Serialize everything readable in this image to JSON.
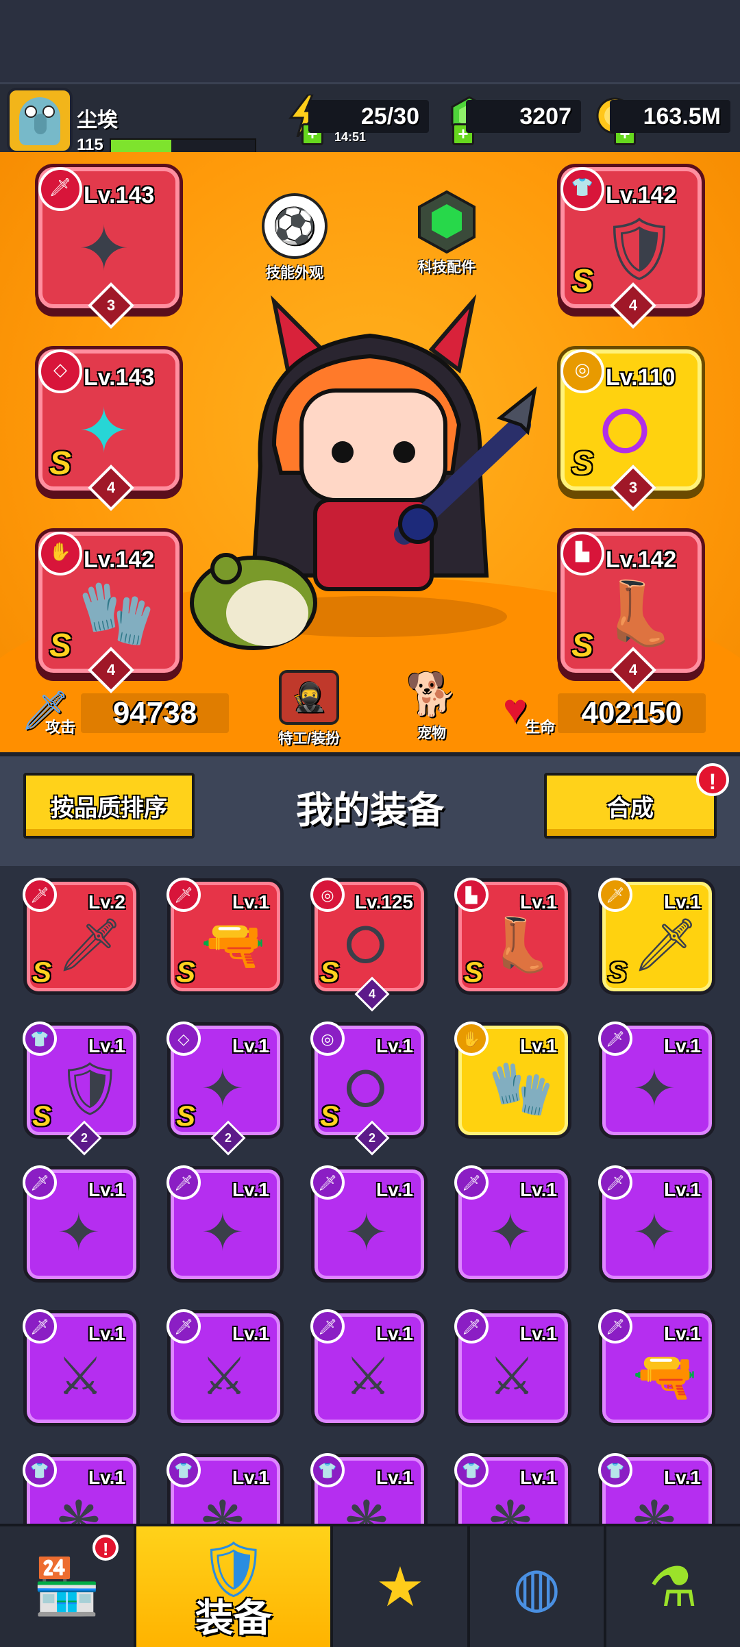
{
  "player": {
    "name": "尘埃",
    "level": "115",
    "xp_progress": 0.42
  },
  "resources": {
    "energy": "25/30",
    "energy_timer": "14:51",
    "gems": "3207",
    "gold": "163.5M"
  },
  "hero": {
    "buttons": {
      "skin": "技能外观",
      "tech": "科技配件",
      "agent": "特工/装扮",
      "pet": "宠物"
    },
    "stats": {
      "attack_label": "攻击",
      "attack": "94738",
      "hp_label": "生命",
      "hp": "402150"
    },
    "equipped": [
      {
        "slot": "weapon",
        "level": "Lv.143",
        "count": "3",
        "rarity": "red",
        "grade": "",
        "art": "kunai"
      },
      {
        "slot": "armor",
        "level": "Lv.142",
        "count": "4",
        "rarity": "red",
        "grade": "S",
        "art": "armor"
      },
      {
        "slot": "necklace",
        "level": "Lv.143",
        "count": "4",
        "rarity": "red",
        "grade": "S",
        "art": "necklace"
      },
      {
        "slot": "belt",
        "level": "Lv.110",
        "count": "3",
        "rarity": "gold",
        "grade": "S",
        "art": "belt"
      },
      {
        "slot": "gloves",
        "level": "Lv.142",
        "count": "4",
        "rarity": "red",
        "grade": "S",
        "art": "gloves"
      },
      {
        "slot": "boots",
        "level": "Lv.142",
        "count": "4",
        "rarity": "red",
        "grade": "S",
        "art": "boots"
      }
    ]
  },
  "section": {
    "sort_button": "按品质排序",
    "title": "我的装备",
    "merge_button": "合成",
    "alert": "!"
  },
  "inventory": [
    [
      {
        "level": "Lv.2",
        "rarity": "red",
        "grade": "S",
        "slot_icon": "🗡",
        "art": "🗡",
        "count": ""
      },
      {
        "level": "Lv.1",
        "rarity": "red",
        "grade": "S",
        "slot_icon": "🗡",
        "art": "🔫",
        "count": ""
      },
      {
        "level": "Lv.125",
        "rarity": "red",
        "grade": "S",
        "slot_icon": "◎",
        "art": "⭘",
        "count": "4"
      },
      {
        "level": "Lv.1",
        "rarity": "red",
        "grade": "S",
        "slot_icon": "▙",
        "art": "👢",
        "count": ""
      },
      {
        "level": "Lv.1",
        "rarity": "gold",
        "grade": "S",
        "slot_icon": "🗡",
        "art": "🗡",
        "count": ""
      }
    ],
    [
      {
        "level": "Lv.1",
        "rarity": "purple",
        "grade": "S",
        "slot_icon": "👕",
        "art": "🛡",
        "count": "2"
      },
      {
        "level": "Lv.1",
        "rarity": "purple",
        "grade": "S",
        "slot_icon": "◇",
        "art": "✦",
        "count": "2"
      },
      {
        "level": "Lv.1",
        "rarity": "purple",
        "grade": "S",
        "slot_icon": "◎",
        "art": "⭘",
        "count": "2"
      },
      {
        "level": "Lv.1",
        "rarity": "gold",
        "grade": "",
        "slot_icon": "✋",
        "art": "🧤",
        "count": ""
      },
      {
        "level": "Lv.1",
        "rarity": "purple",
        "grade": "",
        "slot_icon": "🗡",
        "art": "✦",
        "count": ""
      }
    ],
    [
      {
        "level": "Lv.1",
        "rarity": "purple",
        "grade": "",
        "slot_icon": "🗡",
        "art": "✦",
        "count": ""
      },
      {
        "level": "Lv.1",
        "rarity": "purple",
        "grade": "",
        "slot_icon": "🗡",
        "art": "✦",
        "count": ""
      },
      {
        "level": "Lv.1",
        "rarity": "purple",
        "grade": "",
        "slot_icon": "🗡",
        "art": "✦",
        "count": ""
      },
      {
        "level": "Lv.1",
        "rarity": "purple",
        "grade": "",
        "slot_icon": "🗡",
        "art": "✦",
        "count": ""
      },
      {
        "level": "Lv.1",
        "rarity": "purple",
        "grade": "",
        "slot_icon": "🗡",
        "art": "✦",
        "count": ""
      }
    ],
    [
      {
        "level": "Lv.1",
        "rarity": "purple",
        "grade": "",
        "slot_icon": "🗡",
        "art": "⚔",
        "count": ""
      },
      {
        "level": "Lv.1",
        "rarity": "purple",
        "grade": "",
        "slot_icon": "🗡",
        "art": "⚔",
        "count": ""
      },
      {
        "level": "Lv.1",
        "rarity": "purple",
        "grade": "",
        "slot_icon": "🗡",
        "art": "⚔",
        "count": ""
      },
      {
        "level": "Lv.1",
        "rarity": "purple",
        "grade": "",
        "slot_icon": "🗡",
        "art": "⚔",
        "count": ""
      },
      {
        "level": "Lv.1",
        "rarity": "purple",
        "grade": "",
        "slot_icon": "🗡",
        "art": "🔫",
        "count": ""
      }
    ],
    [
      {
        "level": "Lv.1",
        "rarity": "purple",
        "grade": "",
        "slot_icon": "👕",
        "art": "❋",
        "count": ""
      },
      {
        "level": "Lv.1",
        "rarity": "purple",
        "grade": "",
        "slot_icon": "👕",
        "art": "❋",
        "count": ""
      },
      {
        "level": "Lv.1",
        "rarity": "purple",
        "grade": "",
        "slot_icon": "👕",
        "art": "❋",
        "count": ""
      },
      {
        "level": "Lv.1",
        "rarity": "purple",
        "grade": "",
        "slot_icon": "👕",
        "art": "❋",
        "count": ""
      },
      {
        "level": "Lv.1",
        "rarity": "purple",
        "grade": "",
        "slot_icon": "👕",
        "art": "❋",
        "count": ""
      }
    ]
  ],
  "nav": {
    "active_label": "装备",
    "shop_alert": "!"
  }
}
